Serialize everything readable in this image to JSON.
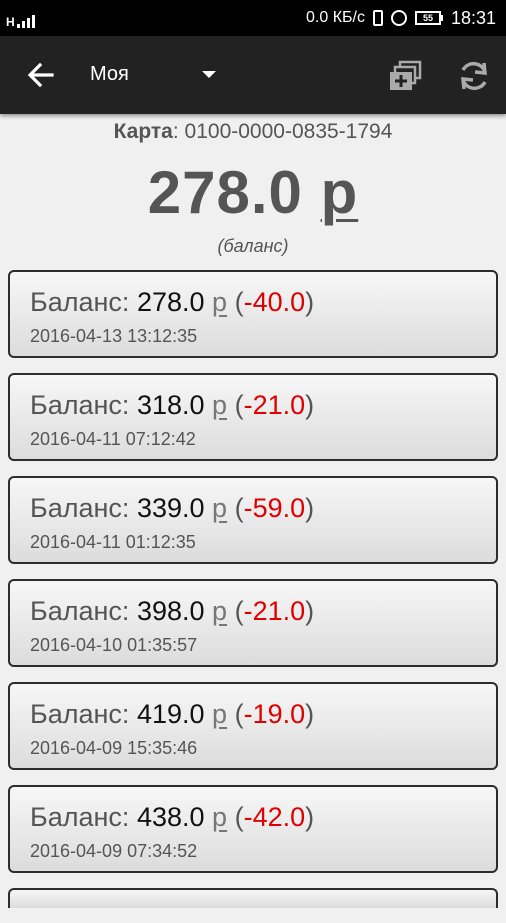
{
  "status_bar": {
    "network": "H",
    "speed": "0.0 КБ/с",
    "battery": "55",
    "time": "18:31"
  },
  "app_bar": {
    "title": "Моя",
    "icons": {
      "back": "arrow-left-icon",
      "dropdown": "chevron-down-icon",
      "cards": "add-card-icon",
      "refresh": "refresh-icon"
    }
  },
  "card": {
    "label": "Карта",
    "number": "0100-0000-0835-1794"
  },
  "balance": {
    "amount": "278.0",
    "currency": "р",
    "caption": "(баланс)"
  },
  "transactions": [
    {
      "label": "Баланс:",
      "balance": "278.0",
      "currency": "р",
      "delta": "-40.0",
      "datetime": "2016-04-13 13:12:35"
    },
    {
      "label": "Баланс:",
      "balance": "318.0",
      "currency": "р",
      "delta": "-21.0",
      "datetime": "2016-04-11 07:12:42"
    },
    {
      "label": "Баланс:",
      "balance": "339.0",
      "currency": "р",
      "delta": "-59.0",
      "datetime": "2016-04-11 01:12:35"
    },
    {
      "label": "Баланс:",
      "balance": "398.0",
      "currency": "р",
      "delta": "-21.0",
      "datetime": "2016-04-10 01:35:57"
    },
    {
      "label": "Баланс:",
      "balance": "419.0",
      "currency": "р",
      "delta": "-19.0",
      "datetime": "2016-04-09 15:35:46"
    },
    {
      "label": "Баланс:",
      "balance": "438.0",
      "currency": "р",
      "delta": "-42.0",
      "datetime": "2016-04-09 07:34:52"
    }
  ],
  "colors": {
    "app_bar": "#222222",
    "negative": "#e00000",
    "text_gray": "#555555"
  }
}
